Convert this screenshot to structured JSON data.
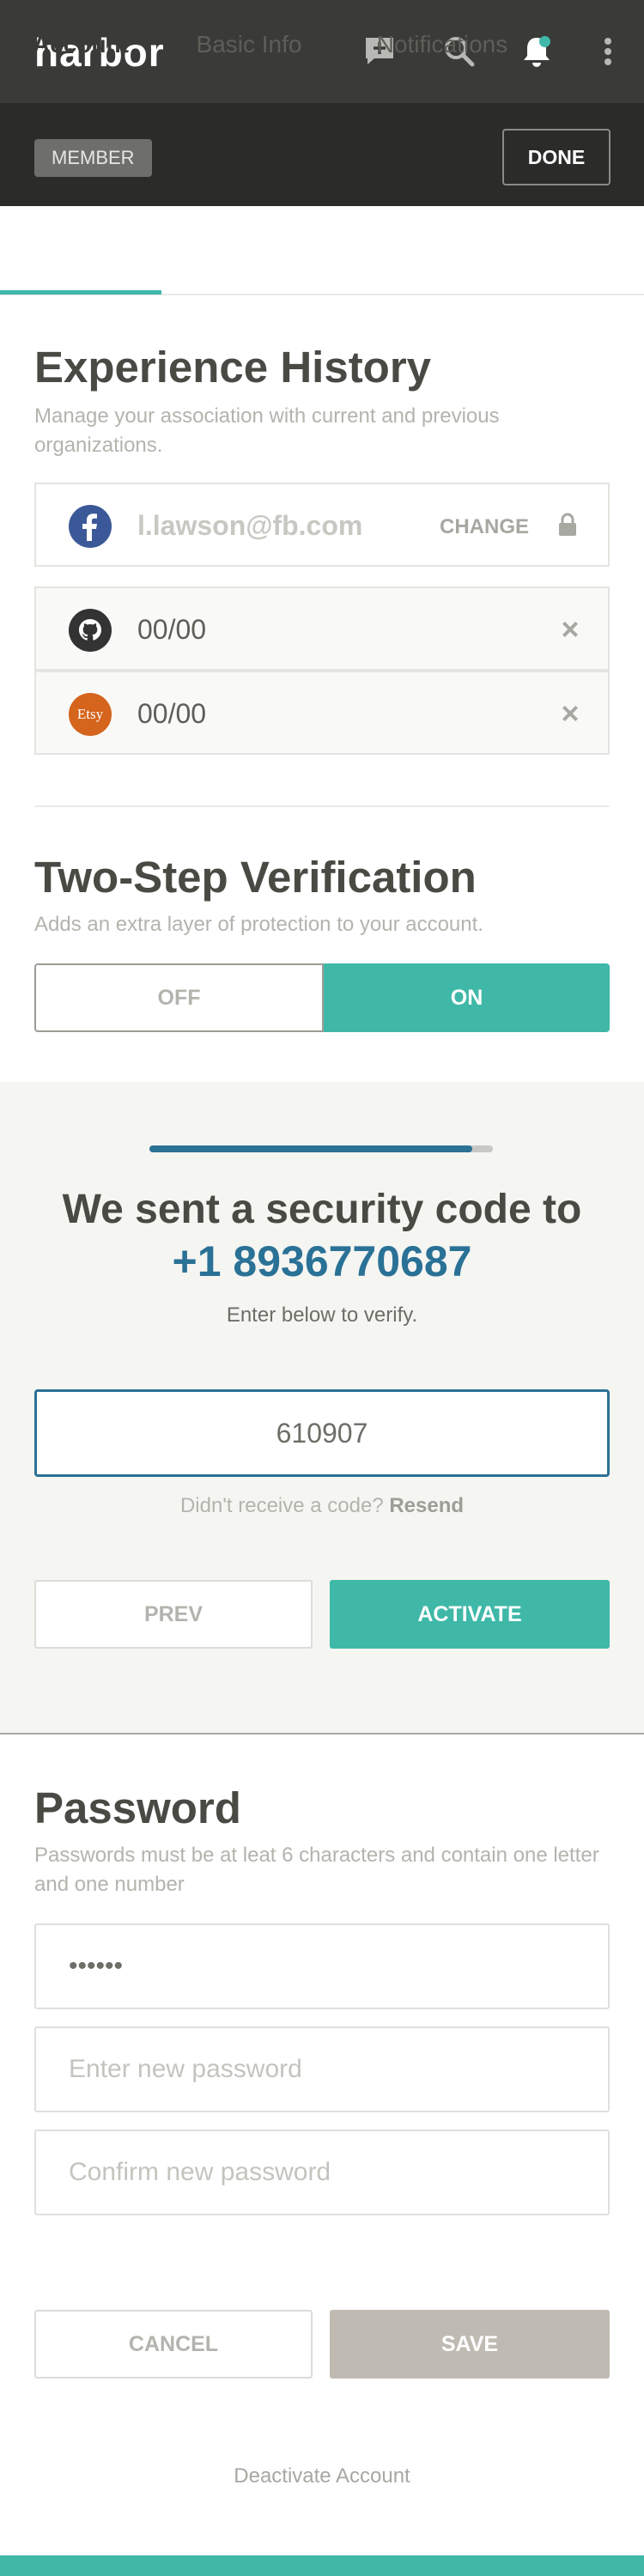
{
  "header": {
    "logo": "harbor"
  },
  "subheader": {
    "badge": "MEMBER",
    "done_label": "DONE"
  },
  "tabs": [
    {
      "label": "Account",
      "active": true
    },
    {
      "label": "Basic Info",
      "active": false
    },
    {
      "label": "Notifications",
      "active": false
    }
  ],
  "experience": {
    "title": "Experience History",
    "description": "Manage your association with current and previous organizations.",
    "accounts": [
      {
        "service": "facebook",
        "value": "l.lawson@fb.com",
        "action": "CHANGE",
        "locked": true
      },
      {
        "service": "github",
        "value": "00/00",
        "removable": true
      },
      {
        "service": "etsy",
        "icon_text": "Etsy",
        "value": "00/00",
        "removable": true
      }
    ]
  },
  "two_step": {
    "title": "Two-Step Verification",
    "description": "Adds an extra layer of protection to your account.",
    "off_label": "OFF",
    "on_label": "ON",
    "state": "on"
  },
  "verify": {
    "progress": 0.94,
    "title": "We sent a security code to",
    "phone": "+1 8936770687",
    "subtitle": "Enter below to verify.",
    "code_value": "610907",
    "resend_prompt": "Didn't receive a code?",
    "resend_link": "Resend",
    "prev_label": "PREV",
    "activate_label": "ACTIVATE"
  },
  "password": {
    "title": "Password",
    "description": "Passwords must be at leat 6 characters and contain one letter and one number",
    "current_value": "••••••",
    "new_placeholder": "Enter new password",
    "confirm_placeholder": "Confirm new password",
    "cancel_label": "CANCEL",
    "save_label": "SAVE"
  },
  "footer": {
    "deactivate_label": "Deactivate Account"
  },
  "colors": {
    "accent": "#3fb8a8",
    "link": "#2a7196",
    "header_bg": "#3a3a38"
  }
}
